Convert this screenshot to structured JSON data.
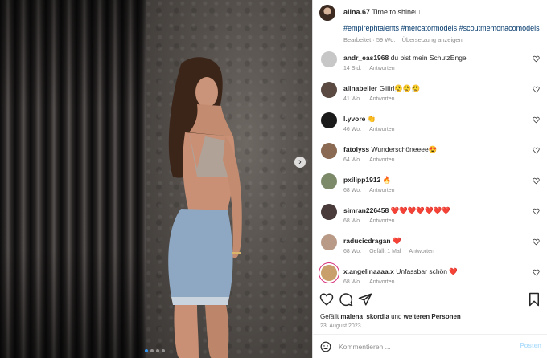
{
  "post": {
    "username": "alina.67",
    "caption": "Time to shine□",
    "hashtags": "#empirephtalents #mercatormodels #scoutmemonacomodels",
    "edited": "Bearbeitet · 59 Wo.",
    "translate": "Übersetzung anzeigen"
  },
  "comments": [
    {
      "user": "andr_eas1968",
      "text": "du bist mein SchutzEngel",
      "time": "14 Std.",
      "reply": "Antworten",
      "likes": "",
      "avatar_color": "#c7c7c7"
    },
    {
      "user": "alinabelier",
      "text": "Giiiirl😮‍💨😮‍💨😮‍💨",
      "time": "41 Wo.",
      "reply": "Antworten",
      "likes": "",
      "avatar_color": "#5b4a42"
    },
    {
      "user": "l.yvore",
      "text": "👏",
      "time": "46 Wo.",
      "reply": "Antworten",
      "likes": "",
      "avatar_color": "#1b1b1b"
    },
    {
      "user": "fatolyss",
      "text": "Wunderschöneeee😍",
      "time": "64 Wo.",
      "reply": "Antworten",
      "likes": "",
      "avatar_color": "#8a6a52"
    },
    {
      "user": "pxilipp1912",
      "text": "🔥",
      "time": "68 Wo.",
      "reply": "Antworten",
      "likes": "",
      "avatar_color": "#7d8a6a"
    },
    {
      "user": "simran226458",
      "text": "❤️❤️❤️❤️❤️❤️❤️",
      "time": "68 Wo.",
      "reply": "Antworten",
      "likes": "",
      "avatar_color": "#4a3b3b"
    },
    {
      "user": "raducicdragan",
      "text": "❤️",
      "time": "68 Wo.",
      "reply": "Antworten",
      "likes": "Gefällt 1 Mal",
      "avatar_color": "#b89a86"
    },
    {
      "user": "x.angelinaaaa.x",
      "text": "Unfassbar schön ❤️",
      "time": "68 Wo.",
      "reply": "Antworten",
      "likes": "",
      "avatar_color": "#c9a06b"
    }
  ],
  "likes_line": {
    "prefix": "Gefällt",
    "user": "malena_skordia",
    "middle": "und",
    "others": "weiteren Personen"
  },
  "date": "23. August 2023",
  "add_comment": {
    "placeholder": "Kommentieren ...",
    "post_label": "Posten"
  },
  "icons": {
    "next": "chevron-right-icon",
    "like": "heart-icon",
    "comment": "comment-icon",
    "share": "paper-plane-icon",
    "save": "bookmark-icon",
    "emoji": "smiley-icon"
  },
  "carousel": {
    "count": 4,
    "active_index": 0
  },
  "colors": {
    "accent": "#3897f0",
    "link": "#00376b",
    "muted": "#8e8e8e",
    "heart": "#ed4956"
  }
}
